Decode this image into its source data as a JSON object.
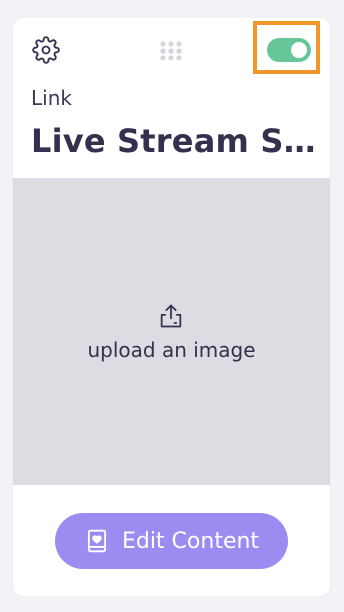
{
  "card": {
    "type_label": "Link",
    "title": "Live Stream Se...",
    "toggle_on": true,
    "upload_text": "upload an image",
    "edit_button_label": "Edit Content"
  },
  "icons": {
    "settings": "gear-icon",
    "drag": "drag-grip-icon",
    "upload": "upload-icon",
    "edit": "book-heart-icon"
  },
  "colors": {
    "toggle_on": "#66c69a",
    "highlight_frame": "#f0962a",
    "button": "#9b8cf2",
    "upload_bg": "#dcdce2",
    "text_dark": "#33314d"
  }
}
